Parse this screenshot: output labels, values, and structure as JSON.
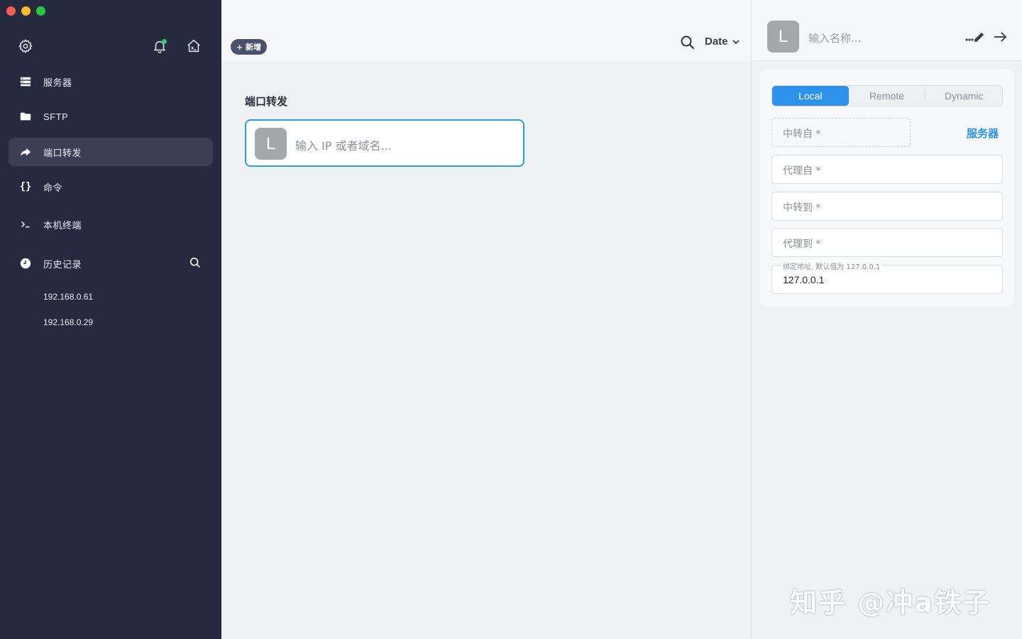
{
  "sidebar": {
    "top_icons": [
      "gear-icon",
      "bell-icon",
      "home-terminal-icon"
    ],
    "items": [
      {
        "label": "服务器",
        "icon": "server-grid-icon"
      },
      {
        "label": "SFTP",
        "icon": "folder-icon"
      },
      {
        "label": "端口转发",
        "icon": "port-forward-icon"
      },
      {
        "label": "命令",
        "icon": "braces-icon"
      },
      {
        "label": "本机终端",
        "icon": "terminal-prompt-icon"
      },
      {
        "label": "历史记录",
        "icon": "clock-icon"
      }
    ],
    "history": [
      "192.168.0.61",
      "192.168.0.29"
    ]
  },
  "middle": {
    "add_button_label": "+ 新增",
    "sort_label": "Date",
    "section_title": "端口转发",
    "host_avatar": "L",
    "host_input_placeholder": "输入 IP 或者域名..."
  },
  "right": {
    "avatar": "L",
    "name_placeholder": "输入名称...",
    "tabs": [
      "Local",
      "Remote",
      "Dynamic"
    ],
    "active_tab": "Local",
    "fields": {
      "relay_from": "中转自 *",
      "server_link": "服务器",
      "proxy_from": "代理自 *",
      "relay_to": "中转到 *",
      "proxy_to": "代理到 *",
      "bind_label": "绑定地址, 默认值为 127.0.0.1",
      "bind_value": "127.0.0.1"
    }
  },
  "watermark": "知乎 @冲a铁子",
  "colors": {
    "sidebar_bg": "#262a3e",
    "accent": "#2e91ea",
    "notification_dot": "#33c17b"
  }
}
